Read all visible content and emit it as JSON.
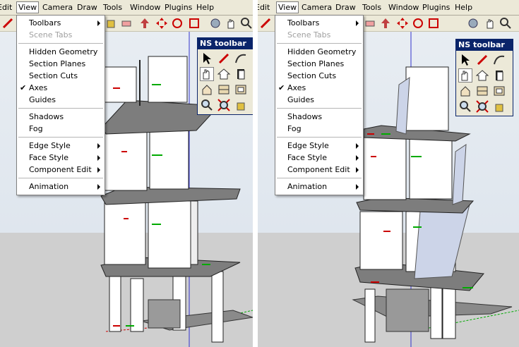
{
  "menubar": {
    "items": [
      "Edit",
      "View",
      "Camera",
      "Draw",
      "Tools",
      "Window",
      "Plugins",
      "Help"
    ]
  },
  "view_menu": {
    "items": [
      {
        "label": "Toolbars",
        "submenu": true
      },
      {
        "label": "Scene Tabs",
        "disabled": true
      },
      {
        "label": "Hidden Geometry"
      },
      {
        "label": "Section Planes"
      },
      {
        "label": "Section Cuts"
      },
      {
        "label": "Axes",
        "checked": true
      },
      {
        "label": "Guides"
      },
      {
        "label": "Shadows"
      },
      {
        "label": "Fog"
      },
      {
        "label": "Edge Style",
        "submenu": true
      },
      {
        "label": "Face Style",
        "submenu": true
      },
      {
        "label": "Component Edit",
        "submenu": true
      },
      {
        "label": "Animation",
        "submenu": true
      }
    ],
    "check_mark": "✔"
  },
  "ns_toolbar": {
    "title": "NS toolbar"
  },
  "colors": {
    "menubar_bg": "#ece9d8",
    "toolbar_title_bg": "#0a246a",
    "axis_red": "#cc0000",
    "axis_green": "#00aa00",
    "axis_blue": "#0000cc",
    "slab_gray": "#7d7d7d",
    "wall_white": "#ffffff"
  },
  "icons": [
    "select-arrow-icon",
    "pencil-icon",
    "arc-icon",
    "orbit-hand-icon",
    "home-icon",
    "page-icon",
    "house-perspective-icon",
    "wall-panel-icon",
    "grid-window-icon",
    "zoom-icon",
    "zoom-extents-icon",
    "paint-bucket-icon"
  ]
}
